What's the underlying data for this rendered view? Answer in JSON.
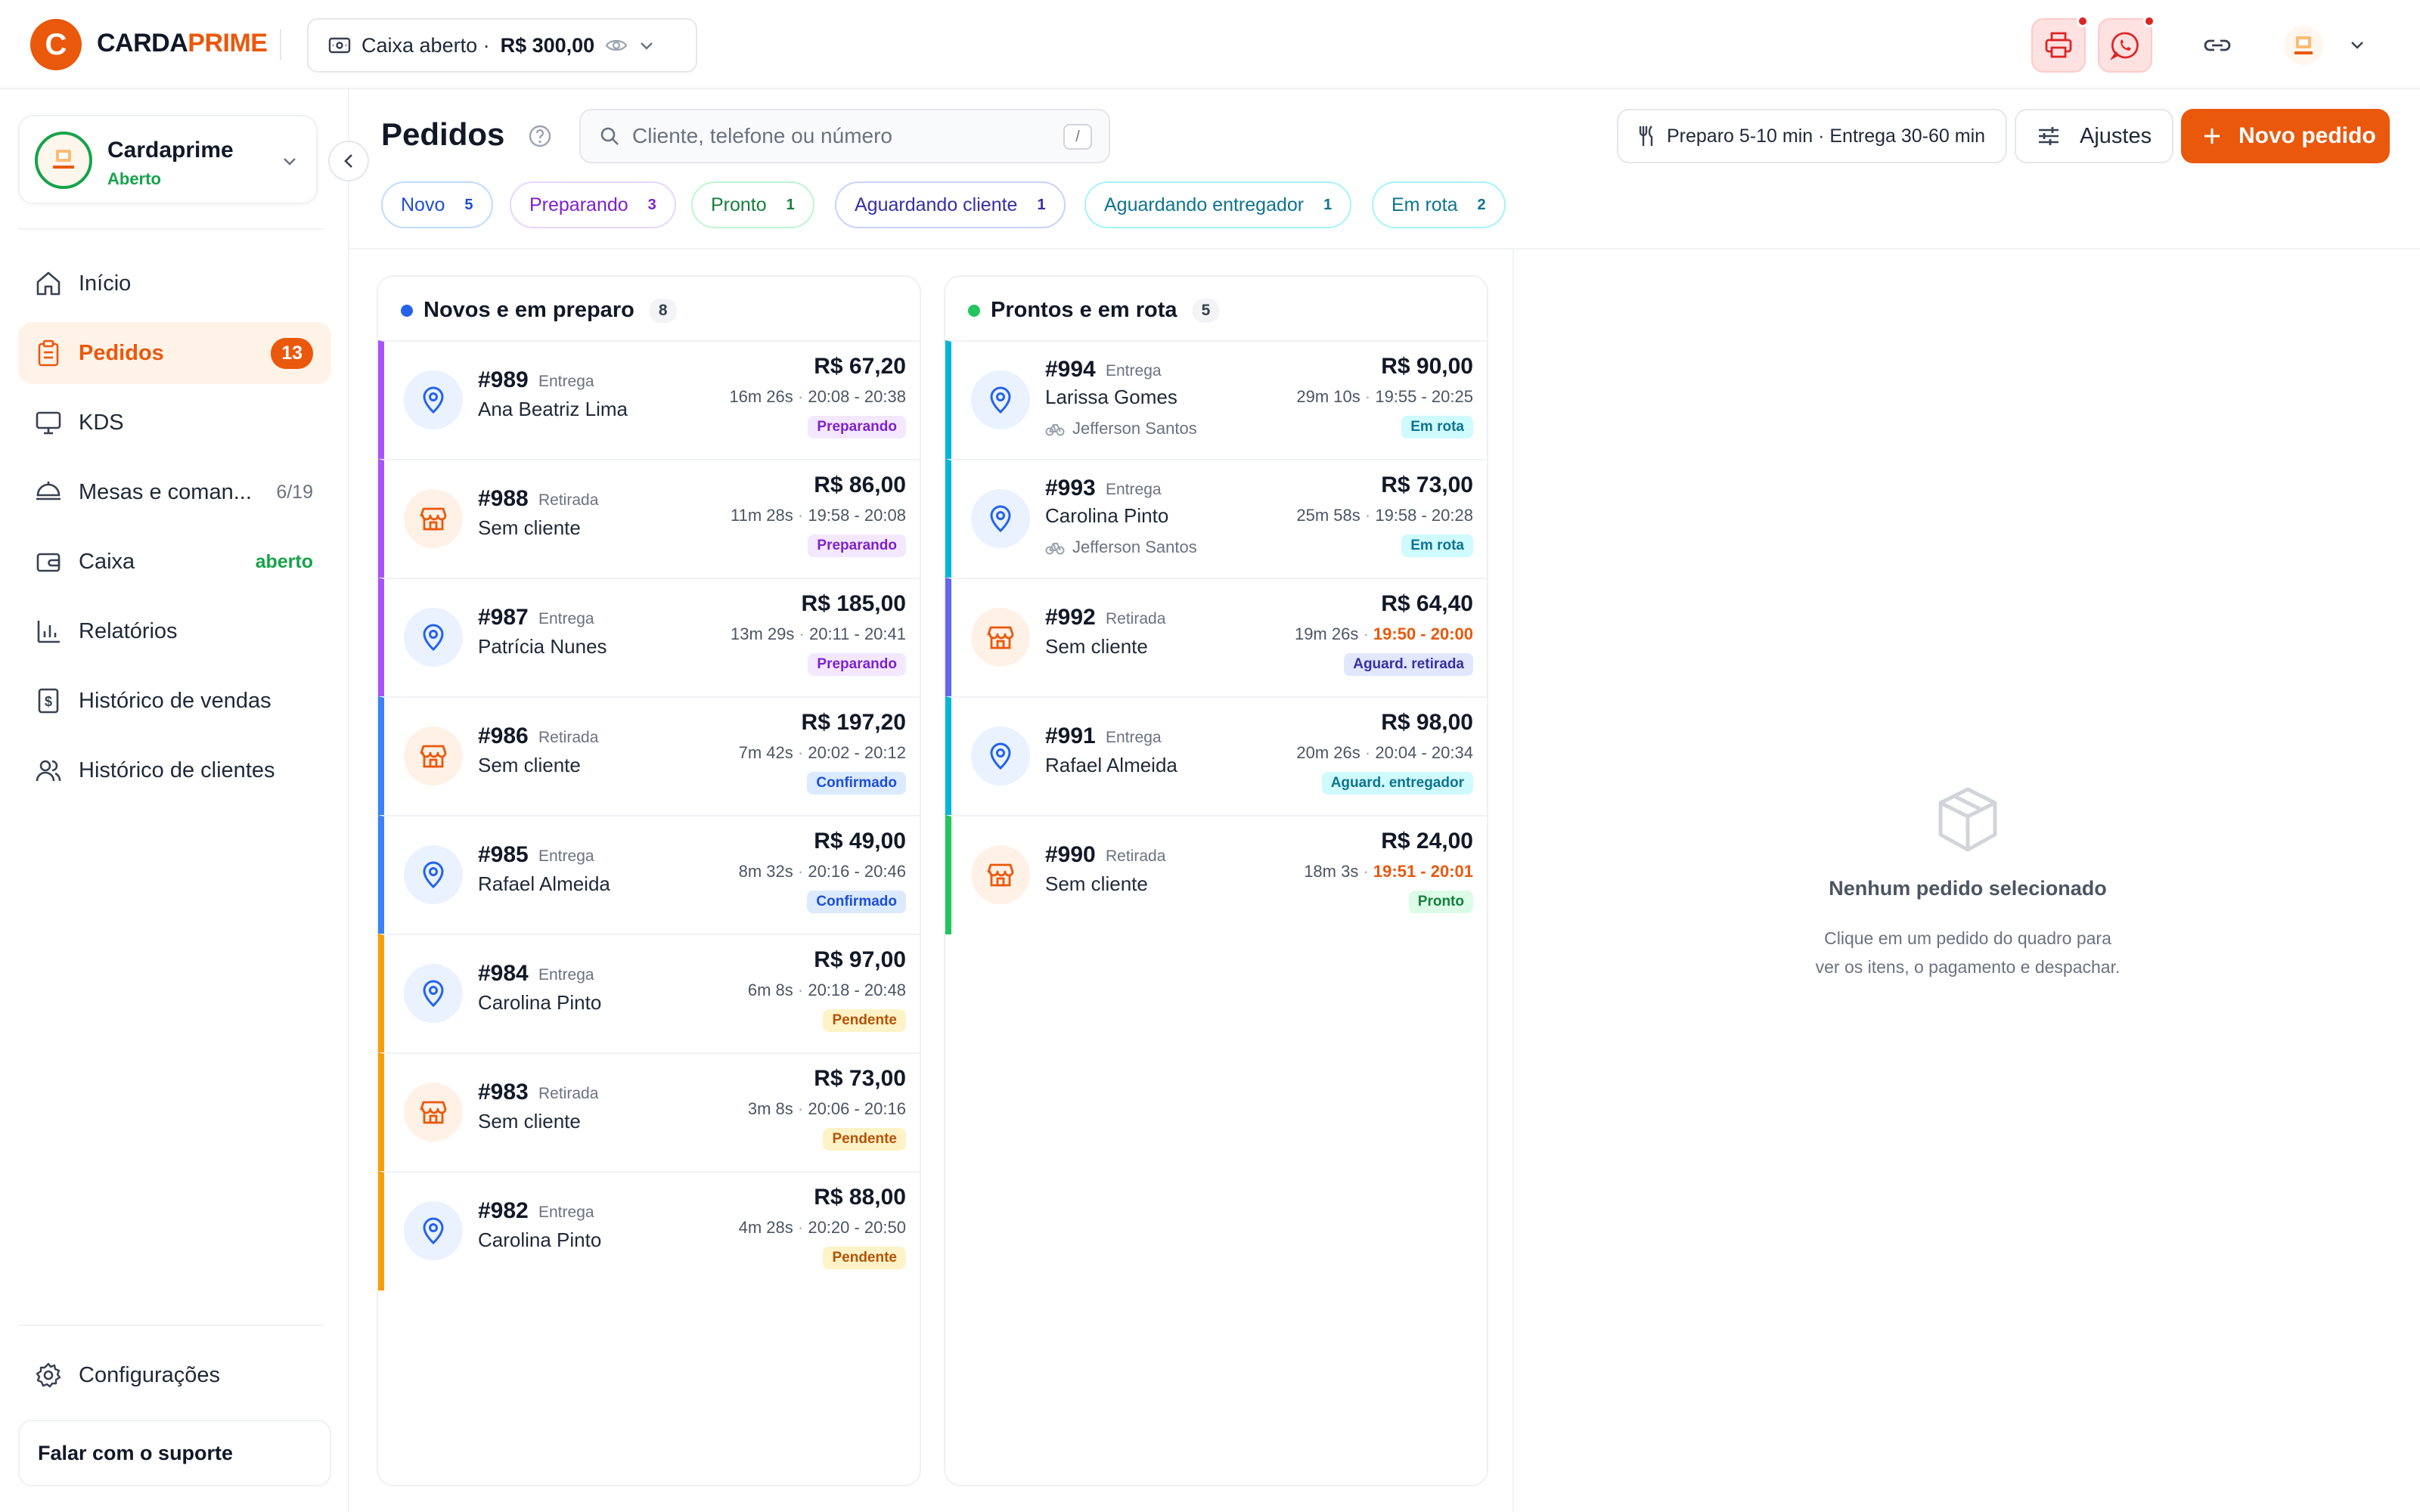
{
  "brand": {
    "initial": "C",
    "name_part1": "CARDA",
    "name_part2": "PRIME",
    "color": "#ea580c"
  },
  "cash": {
    "label": "Caixa aberto ·",
    "amount": "R$ 300,00"
  },
  "store": {
    "name": "Cardaprime",
    "status": "Aberto",
    "avatar_text": "CardaPrime"
  },
  "sidebar": {
    "items": [
      {
        "label": "Início",
        "icon": "home-icon"
      },
      {
        "label": "Pedidos",
        "icon": "clipboard-icon",
        "badge": "13"
      },
      {
        "label": "KDS",
        "icon": "monitor-icon"
      },
      {
        "label": "Mesas e coman...",
        "icon": "dish-icon",
        "right": "6/19"
      },
      {
        "label": "Caixa",
        "icon": "wallet-icon",
        "right": "aberto"
      },
      {
        "label": "Relatórios",
        "icon": "bar-chart-icon"
      },
      {
        "label": "Histórico de vendas",
        "icon": "receipt-icon"
      },
      {
        "label": "Histórico de clientes",
        "icon": "users-icon"
      }
    ],
    "settings": "Configurações",
    "support": "Falar com o suporte"
  },
  "header": {
    "title": "Pedidos",
    "search_placeholder": "Cliente, telefone ou número",
    "search_shortcut": "/",
    "prep_info": "Preparo 5-10 min · Entrega 30-60 min",
    "settings_label": "Ajustes",
    "new_order_label": "Novo pedido"
  },
  "chips": [
    {
      "label": "Novo",
      "count": "5",
      "color": "#1d4ed8"
    },
    {
      "label": "Preparando",
      "count": "3",
      "color": "#7e22ce"
    },
    {
      "label": "Pronto",
      "count": "1",
      "color": "#15803d"
    },
    {
      "label": "Aguardando cliente",
      "count": "1",
      "color": "#3730a3"
    },
    {
      "label": "Aguardando entregador",
      "count": "1",
      "color": "#0e7490"
    },
    {
      "label": "Em rota",
      "count": "2",
      "color": "#0e7490"
    }
  ],
  "columns": [
    {
      "title": "Novos e em preparo",
      "count": "8",
      "dot_color": "#2563eb",
      "orders": [
        {
          "num": "#989",
          "type": "Entrega",
          "name": "Ana Beatriz Lima",
          "amount": "R$ 67,20",
          "elapsed": "16m 26s",
          "window": "20:08 - 20:38",
          "late": false,
          "status": "Preparando",
          "status_key": "preparando",
          "bar": "#a855f7"
        },
        {
          "num": "#988",
          "type": "Retirada",
          "name": "Sem cliente",
          "amount": "R$ 86,00",
          "elapsed": "11m 28s",
          "window": "19:58 - 20:08",
          "late": false,
          "status": "Preparando",
          "status_key": "preparando",
          "bar": "#a855f7"
        },
        {
          "num": "#987",
          "type": "Entrega",
          "name": "Patrícia Nunes",
          "amount": "R$ 185,00",
          "elapsed": "13m 29s",
          "window": "20:11 - 20:41",
          "late": false,
          "status": "Preparando",
          "status_key": "preparando",
          "bar": "#a855f7"
        },
        {
          "num": "#986",
          "type": "Retirada",
          "name": "Sem cliente",
          "amount": "R$ 197,20",
          "elapsed": "7m 42s",
          "window": "20:02 - 20:12",
          "late": false,
          "status": "Confirmado",
          "status_key": "confirmado",
          "bar": "#3b82f6"
        },
        {
          "num": "#985",
          "type": "Entrega",
          "name": "Rafael Almeida",
          "amount": "R$ 49,00",
          "elapsed": "8m 32s",
          "window": "20:16 - 20:46",
          "late": false,
          "status": "Confirmado",
          "status_key": "confirmado",
          "bar": "#3b82f6"
        },
        {
          "num": "#984",
          "type": "Entrega",
          "name": "Carolina Pinto",
          "amount": "R$ 97,00",
          "elapsed": "6m 8s",
          "window": "20:18 - 20:48",
          "late": false,
          "status": "Pendente",
          "status_key": "pendente",
          "bar": "#f59e0b"
        },
        {
          "num": "#983",
          "type": "Retirada",
          "name": "Sem cliente",
          "amount": "R$ 73,00",
          "elapsed": "3m 8s",
          "window": "20:06 - 20:16",
          "late": false,
          "status": "Pendente",
          "status_key": "pendente",
          "bar": "#f59e0b"
        },
        {
          "num": "#982",
          "type": "Entrega",
          "name": "Carolina Pinto",
          "amount": "R$ 88,00",
          "elapsed": "4m 28s",
          "window": "20:20 - 20:50",
          "late": false,
          "status": "Pendente",
          "status_key": "pendente",
          "bar": "#f59e0b"
        }
      ]
    },
    {
      "title": "Prontos e em rota",
      "count": "5",
      "dot_color": "#22c55e",
      "orders": [
        {
          "num": "#994",
          "type": "Entrega",
          "name": "Larissa Gomes",
          "courier": "Jefferson Santos",
          "amount": "R$ 90,00",
          "elapsed": "29m 10s",
          "window": "19:55 - 20:25",
          "late": false,
          "status": "Em rota",
          "status_key": "emrota",
          "bar": "#06b6d4"
        },
        {
          "num": "#993",
          "type": "Entrega",
          "name": "Carolina Pinto",
          "courier": "Jefferson Santos",
          "amount": "R$ 73,00",
          "elapsed": "25m 58s",
          "window": "19:58 - 20:28",
          "late": false,
          "status": "Em rota",
          "status_key": "emrota",
          "bar": "#06b6d4"
        },
        {
          "num": "#992",
          "type": "Retirada",
          "name": "Sem cliente",
          "amount": "R$ 64,40",
          "elapsed": "19m 26s",
          "window": "19:50 - 20:00",
          "late": true,
          "status": "Aguard. retirada",
          "status_key": "retirada",
          "bar": "#6366f1"
        },
        {
          "num": "#991",
          "type": "Entrega",
          "name": "Rafael Almeida",
          "amount": "R$ 98,00",
          "elapsed": "20m 26s",
          "window": "20:04 - 20:34",
          "late": false,
          "status": "Aguard. entregador",
          "status_key": "entregador",
          "bar": "#06b6d4"
        },
        {
          "num": "#990",
          "type": "Retirada",
          "name": "Sem cliente",
          "amount": "R$ 24,00",
          "elapsed": "18m 3s",
          "window": "19:51 - 20:01",
          "late": true,
          "status": "Pronto",
          "status_key": "pronto",
          "bar": "#22c55e"
        }
      ]
    }
  ],
  "detail": {
    "empty_title": "Nenhum pedido selecionado",
    "empty_line1": "Clique em um pedido do quadro para",
    "empty_line2": "ver os itens, o pagamento e despachar."
  }
}
